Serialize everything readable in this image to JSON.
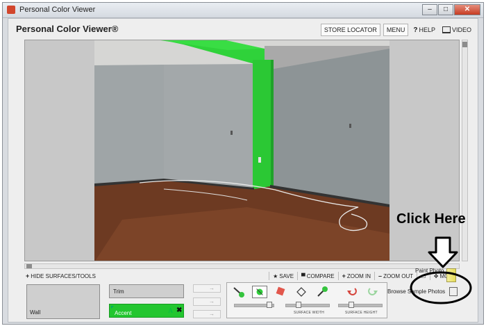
{
  "window": {
    "title": "Personal Color Viewer",
    "controls": {
      "minimize": "–",
      "maximize": "□",
      "close": "✕"
    }
  },
  "header": {
    "brand": "Personal Color Viewer®",
    "store_locator": "STORE LOCATOR",
    "menu": "MENU",
    "help": "HELP",
    "help_glyph": "?",
    "video": "VIDEO"
  },
  "toolbar": {
    "hide_glyph": "+",
    "hide_label": "HIDE SURFACES/TOOLS",
    "save_label": "SAVE",
    "compare_label": "COMPARE",
    "zoom_in_glyph": "+",
    "zoom_in_label": "ZOOM IN",
    "zoom_out_glyph": "–",
    "zoom_out_label": "ZOOM OUT",
    "move_label": "MOVE"
  },
  "surfaces": {
    "wall": "Wall",
    "trim": "Trim",
    "accent": "Accent",
    "accent_badge": "A",
    "accent_remove": "✖",
    "accent_color": "#23c62f"
  },
  "tools": {
    "surface_width_label": "SURFACE WIDTH",
    "surface_height_label": "SURFACE HEIGHT"
  },
  "side_actions": {
    "paint_photo": "Paint Photo",
    "browse_samples": "Browse Sample Photos"
  },
  "annotation": {
    "text": "Click Here"
  }
}
